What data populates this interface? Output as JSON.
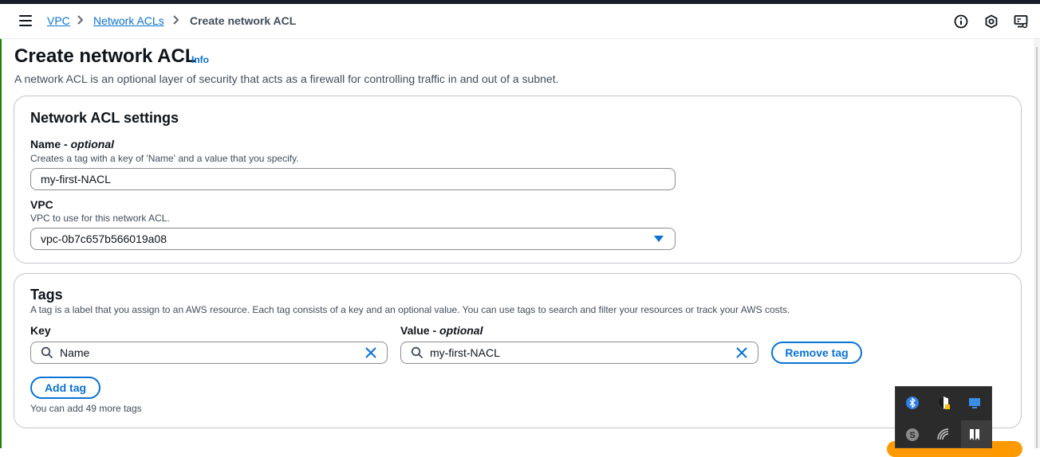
{
  "breadcrumb": {
    "items": [
      "VPC",
      "Network ACLs"
    ],
    "current": "Create network ACL"
  },
  "header_icons": [
    "info-circle-icon",
    "feedback-hexagon-icon",
    "screen-settings-icon"
  ],
  "page": {
    "title": "Create network ACL",
    "info_label": "Info",
    "description": "A network ACL is an optional layer of security that acts as a firewall for controlling traffic in and out of a subnet."
  },
  "settings": {
    "heading": "Network ACL settings",
    "name_label": "Name",
    "name_optional": "optional",
    "name_hint": "Creates a tag with a key of 'Name' and a value that you specify.",
    "name_value": "my-first-NACL",
    "vpc_label": "VPC",
    "vpc_hint": "VPC to use for this network ACL.",
    "vpc_value": "vpc-0b7c657b566019a08"
  },
  "tags": {
    "heading": "Tags",
    "description": "A tag is a label that you assign to an AWS resource. Each tag consists of a key and an optional value. You can use tags to search and filter your resources or track your AWS costs.",
    "key_label": "Key",
    "value_label": "Value",
    "value_optional": "optional",
    "rows": [
      {
        "key": "Name",
        "value": "my-first-NACL"
      }
    ],
    "remove_label": "Remove tag",
    "add_label": "Add tag",
    "remaining_hint": "You can add 49 more tags"
  },
  "tray": {
    "icons": [
      "bluetooth-icon",
      "windows-security-icon",
      "display-icon",
      "skype-icon",
      "wifi-icon",
      "snip-tool-icon"
    ]
  },
  "colors": {
    "link": "#0972d3",
    "text": "#0f141a",
    "border": "#c6c6cd",
    "accent_orange": "#ff9900"
  }
}
